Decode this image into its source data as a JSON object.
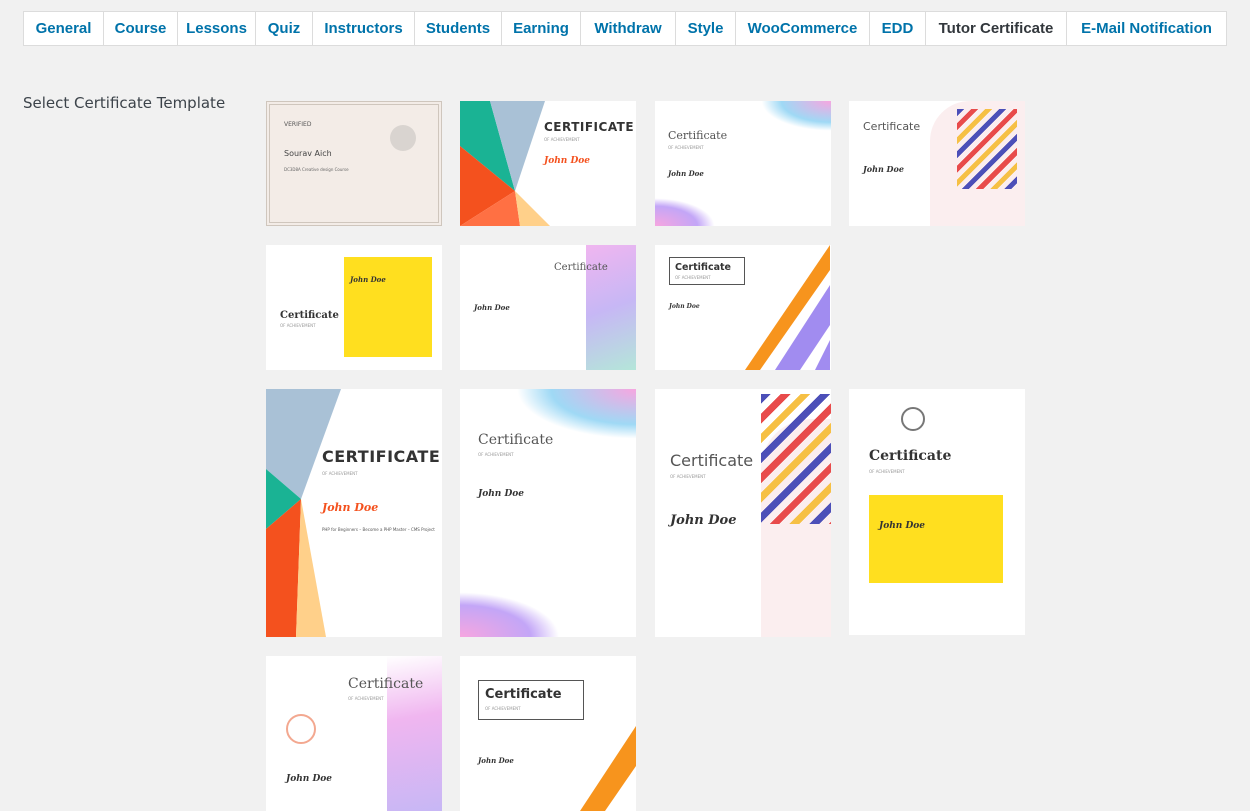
{
  "tabs": [
    {
      "label": "General",
      "active": false
    },
    {
      "label": "Course",
      "active": false
    },
    {
      "label": "Lessons",
      "active": false
    },
    {
      "label": "Quiz",
      "active": false
    },
    {
      "label": "Instructors",
      "active": false
    },
    {
      "label": "Students",
      "active": false
    },
    {
      "label": "Earning",
      "active": false
    },
    {
      "label": "Withdraw",
      "active": false
    },
    {
      "label": "Style",
      "active": false
    },
    {
      "label": "WooCommerce",
      "active": false
    },
    {
      "label": "EDD",
      "active": false
    },
    {
      "label": "Tutor Certificate",
      "active": true
    },
    {
      "label": "E-Mail Notification",
      "active": false
    }
  ],
  "section_label": "Select Certificate Template",
  "templates": {
    "t1": {
      "heading": "VERIFIED",
      "name": "Sourav Aich",
      "course": "DC3D8A Creative design Course"
    },
    "cert_upper": "CERTIFICATE",
    "cert_title": "Certificate",
    "of_achievement": "OF ACHIEVEMENT",
    "name": "John Doe",
    "course": "PHP for Beginners – Become a PHP Master – CMS Project"
  },
  "colors": {
    "tab_link": "#0073aa",
    "tab_active": "#32373c",
    "background": "#f1f1f1"
  }
}
